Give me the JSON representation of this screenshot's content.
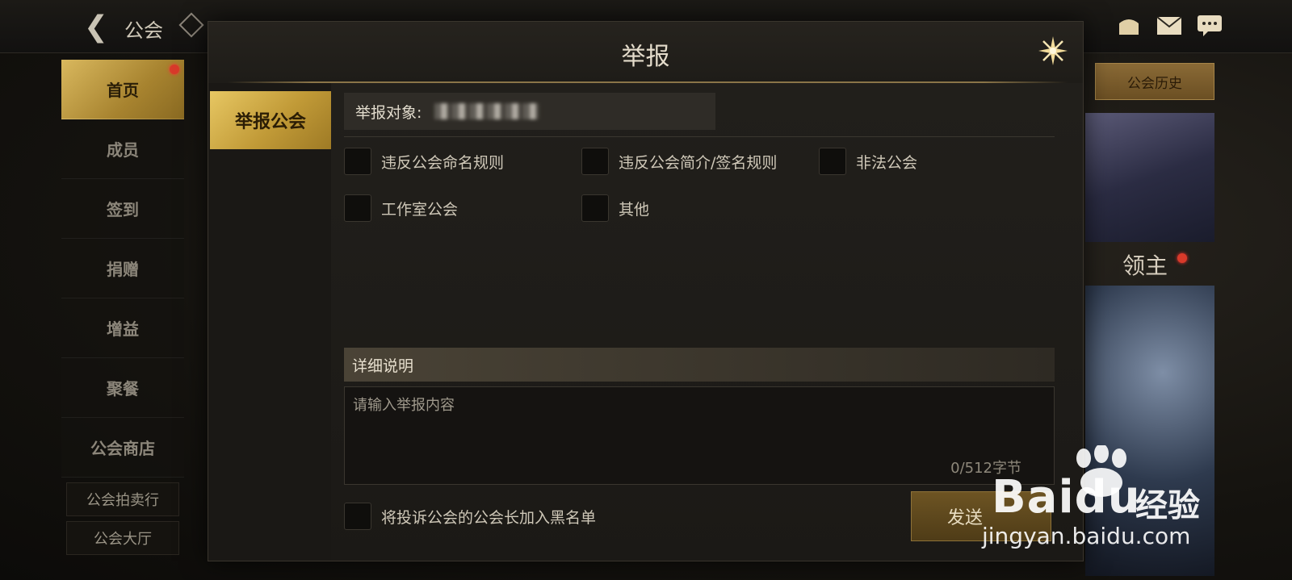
{
  "background": {
    "title": "公会",
    "side_nav": [
      {
        "label": "首页",
        "active": true,
        "badge": true
      },
      {
        "label": "成员",
        "active": false
      },
      {
        "label": "签到",
        "active": false
      },
      {
        "label": "捐赠",
        "active": false
      },
      {
        "label": "增益",
        "active": false
      },
      {
        "label": "聚餐",
        "active": false
      },
      {
        "label": "公会商店",
        "active": false
      }
    ],
    "side_sub": [
      "公会拍卖行",
      "公会大厅"
    ],
    "history_button": "公会历史",
    "right_label": "领主",
    "icons": [
      "chest-icon",
      "mail-icon",
      "chat-icon"
    ]
  },
  "modal": {
    "title": "举报",
    "tab": "举报公会",
    "target_label": "举报对象:",
    "options": [
      {
        "label": "违反公会命名规则",
        "checked": false
      },
      {
        "label": "违反公会简介/签名规则",
        "checked": false
      },
      {
        "label": "非法公会",
        "checked": false
      },
      {
        "label": "工作室公会",
        "checked": false
      },
      {
        "label": "其他",
        "checked": false
      }
    ],
    "detail_label": "详细说明",
    "detail_placeholder": "请输入举报内容",
    "char_count": "0/512字节",
    "blacklist_label": "将投诉公会的公会长加入黑名单",
    "send_label": "发送"
  },
  "watermark": {
    "brand": "Baidu",
    "jingyan": "经验",
    "url": "jingyan.baidu.com"
  }
}
